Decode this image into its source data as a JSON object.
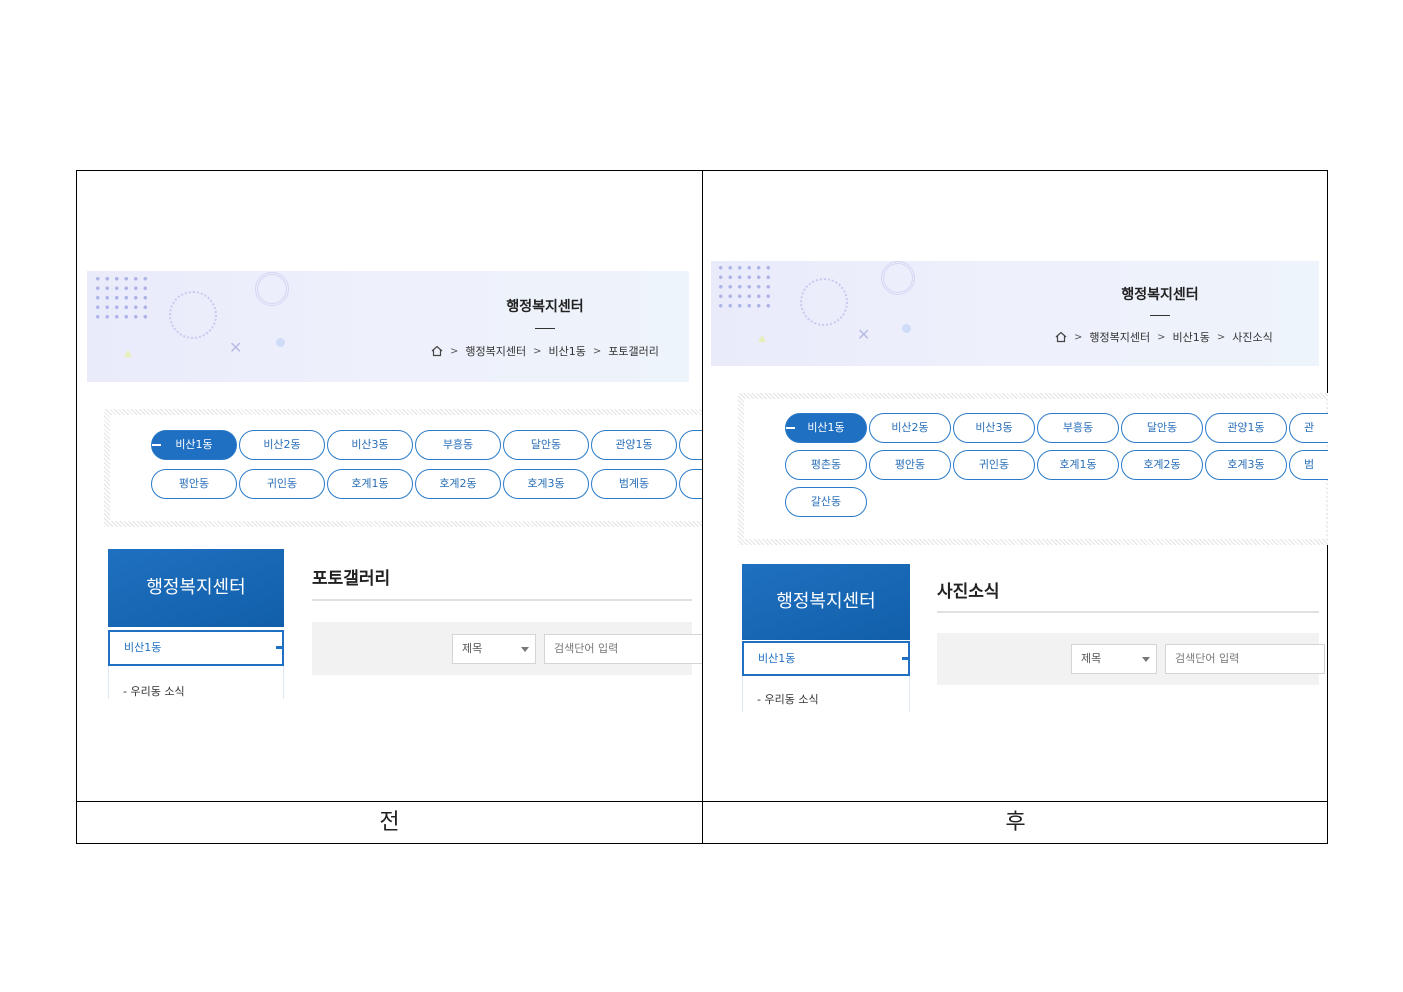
{
  "before": {
    "banner": {
      "title": "행정복지센터",
      "breadcrumb": [
        "행정복지센터",
        "비산1동",
        "포토갤러리"
      ]
    },
    "dong_tabs": {
      "row1": [
        "비산1동",
        "비산2동",
        "비산3동",
        "부흥동",
        "달안동",
        "관양1동"
      ],
      "row2": [
        "평안동",
        "귀인동",
        "호계1동",
        "호계2동",
        "호계3동",
        "범계동"
      ]
    },
    "sidebar": {
      "title": "행정복지센터",
      "selected": "비산1동",
      "sub_item": "- 우리동 소식"
    },
    "content": {
      "title": "포토갤러리",
      "search_select": "제목",
      "search_placeholder": "검색단어 입력"
    }
  },
  "after": {
    "banner": {
      "title": "행정복지센터",
      "breadcrumb": [
        "행정복지센터",
        "비산1동",
        "사진소식"
      ]
    },
    "dong_tabs": {
      "row1": [
        "비산1동",
        "비산2동",
        "비산3동",
        "부흥동",
        "달안동",
        "관양1동",
        "관"
      ],
      "row2": [
        "평촌동",
        "평안동",
        "귀인동",
        "호계1동",
        "호계2동",
        "호계3동",
        "범"
      ],
      "row3": [
        "갈산동"
      ]
    },
    "sidebar": {
      "title": "행정복지센터",
      "selected": "비산1동",
      "sub_item": "- 우리동 소식"
    },
    "content": {
      "title": "사진소식",
      "search_select": "제목",
      "search_placeholder": "검색단어 입력"
    }
  },
  "captions": {
    "before": "전",
    "after": "후"
  }
}
